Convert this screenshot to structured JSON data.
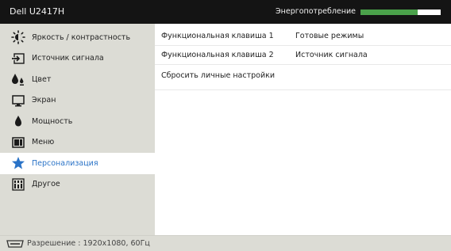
{
  "header": {
    "model": "Dell U2417H",
    "energy_label": "Энергопотребление",
    "energy_level_fraction": 0.71,
    "energy_bar_color": "#4ba24b"
  },
  "sidebar": {
    "items": [
      {
        "label": "Яркость / контрастность",
        "icon": "brightness-icon",
        "selected": false
      },
      {
        "label": "Источник сигнала",
        "icon": "input-source-icon",
        "selected": false
      },
      {
        "label": "Цвет",
        "icon": "color-icon",
        "selected": false
      },
      {
        "label": "Экран",
        "icon": "display-icon",
        "selected": false
      },
      {
        "label": "Мощность",
        "icon": "power-icon",
        "selected": false
      },
      {
        "label": "Меню",
        "icon": "menu-icon",
        "selected": false
      },
      {
        "label": "Персонализация",
        "icon": "star-icon",
        "selected": true
      },
      {
        "label": "Другое",
        "icon": "others-icon",
        "selected": false
      }
    ],
    "accent_color": "#2a73c7"
  },
  "content": {
    "rows": [
      {
        "key": "Функциональная клавиша 1",
        "value": "Готовые режимы"
      },
      {
        "key": "Функциональная клавиша 2",
        "value": "Источник сигнала"
      },
      {
        "key": "Сбросить личные настройки",
        "value": ""
      }
    ]
  },
  "footer": {
    "resolution_text": "Разрешение : 1920x1080, 60Гц",
    "icon": "video-connector-icon"
  }
}
